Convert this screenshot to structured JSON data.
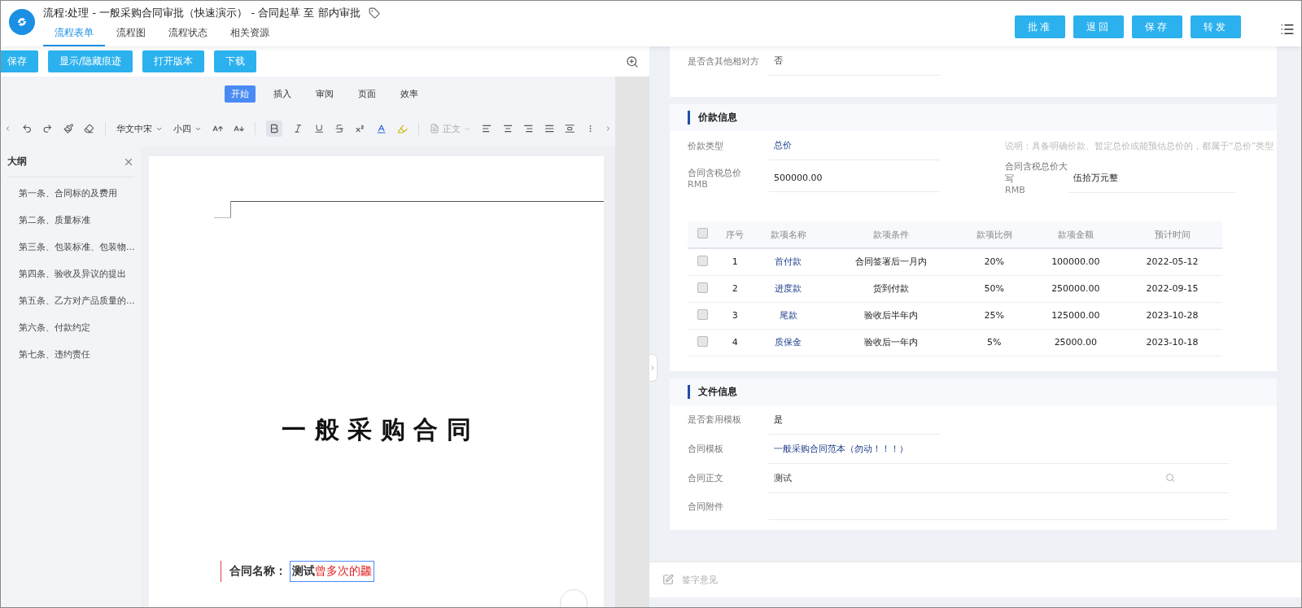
{
  "app": {
    "title": "流程:处理 - 一般采购合同审批（快速演示） - 合同起草 至 部内审批"
  },
  "nav_tabs": [
    {
      "label": "流程表单",
      "selected": true
    },
    {
      "label": "流程图",
      "selected": false
    },
    {
      "label": "流程状态",
      "selected": false
    },
    {
      "label": "相关资源",
      "selected": false
    }
  ],
  "actions": [
    "批准",
    "退回",
    "保存",
    "转发"
  ],
  "editor": {
    "buttons": [
      "保存",
      "显示/隐藏痕迹",
      "打开版本",
      "下载"
    ],
    "ribbon_tabs": [
      {
        "label": "开始",
        "selected": true
      },
      {
        "label": "插入",
        "selected": false
      },
      {
        "label": "审阅",
        "selected": false
      },
      {
        "label": "页面",
        "selected": false
      },
      {
        "label": "效率",
        "selected": false
      }
    ],
    "toolbar": {
      "font": "华文中宋",
      "size": "小四",
      "style": "正文",
      "bold": true
    },
    "outline": {
      "title": "大纲",
      "items": [
        "第一条、合同标的及费用",
        "第二条、质量标准",
        "第三条、包装标准、包装物...",
        "第四条、验收及异议的提出",
        "第五条、乙方对产品质量的...",
        "第六条、付款约定",
        "第七条、违约责任"
      ]
    },
    "document": {
      "heading": "一 般 采 购 合 同",
      "field_label": "合同名称：",
      "field_value": "测试",
      "inserted_text": "曾多次的龘"
    }
  },
  "form": {
    "top_field": {
      "label": "是否含其他相对方",
      "value": "否"
    },
    "price": {
      "title": "价款信息",
      "type_label": "价款类型",
      "type_value": "总价",
      "note": "说明：具备明确价款、暂定总价或能预估总价的，都属于“总价”类型",
      "total": {
        "label": "合同含税总价",
        "unit": "RMB",
        "value": "500000.00"
      },
      "total_words": {
        "label": "合同含税总价大写",
        "unit": "RMB",
        "value": "伍拾万元整"
      },
      "table": {
        "header_checked": false,
        "columns": [
          "序号",
          "款项名称",
          "款项条件",
          "款项比例",
          "款项金额",
          "预计时间"
        ],
        "rows": [
          {
            "checked": false,
            "cells": [
              "1",
              "首付款",
              "合同签署后一月内",
              "20%",
              "100000.00",
              "2022-05-12"
            ]
          },
          {
            "checked": false,
            "cells": [
              "2",
              "进度款",
              "货到付款",
              "50%",
              "250000.00",
              "2022-09-15"
            ]
          },
          {
            "checked": false,
            "cells": [
              "3",
              "尾款",
              "验收后半年内",
              "25%",
              "125000.00",
              "2023-10-28"
            ]
          },
          {
            "checked": false,
            "cells": [
              "4",
              "质保金",
              "验收后一年内",
              "5%",
              "25000.00",
              "2023-10-18"
            ]
          }
        ]
      }
    },
    "files": {
      "title": "文件信息",
      "fields": [
        {
          "kind": "text",
          "label": "是否套用模板",
          "value": "是"
        },
        {
          "kind": "link",
          "label": "合同模板",
          "value": "一般采购合同范本（勿动！！！）"
        },
        {
          "kind": "search",
          "label": "合同正文",
          "value": "测试"
        },
        {
          "kind": "empty",
          "label": "合同附件"
        }
      ]
    }
  },
  "sign": {
    "placeholder": "签字意见"
  }
}
